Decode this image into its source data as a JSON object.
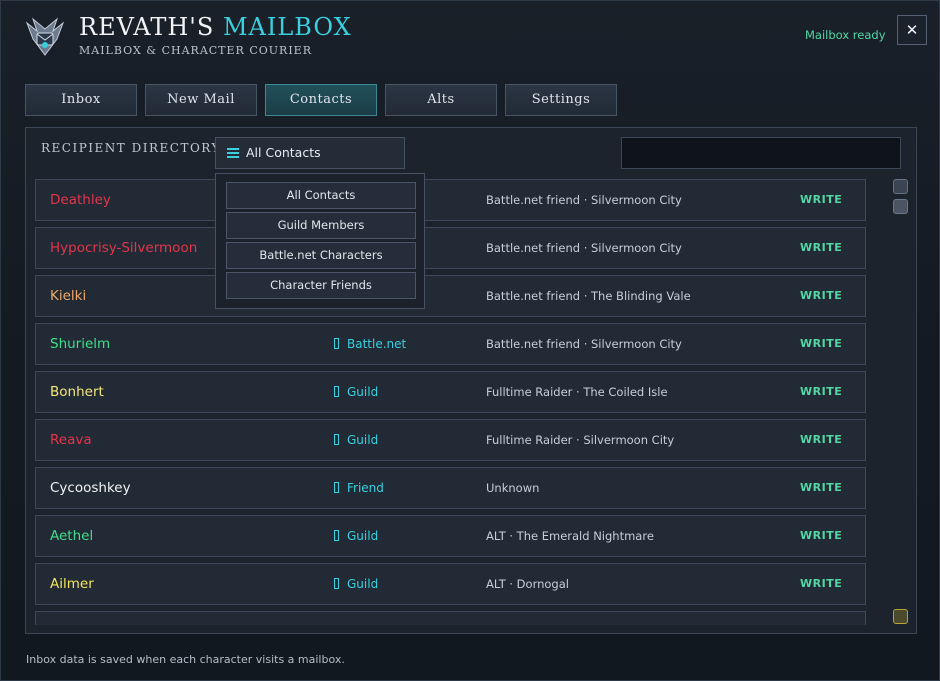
{
  "header": {
    "title_prefix": "REVATH'S",
    "title_accent": "MAILBOX",
    "subtitle": "MAILBOX & CHARACTER COURIER",
    "status": "Mailbox ready",
    "close_label": "✕"
  },
  "tabs": [
    {
      "label": "Inbox",
      "active": false
    },
    {
      "label": "New Mail",
      "active": false
    },
    {
      "label": "Contacts",
      "active": true
    },
    {
      "label": "Alts",
      "active": false
    },
    {
      "label": "Settings",
      "active": false
    }
  ],
  "directory": {
    "label": "RECIPIENT DIRECTORY",
    "filter_value": "All Contacts",
    "search_value": "",
    "filter_options": [
      "All Contacts",
      "Guild Members",
      "Battle.net Characters",
      "Character Friends"
    ]
  },
  "contacts": [
    {
      "name": "Deathley",
      "name_color": "#e5344a",
      "relation": "",
      "location": "Battle.net friend · Silvermoon City",
      "action": "WRITE"
    },
    {
      "name": "Hypocrisy-Silvermoon",
      "name_color": "#e5344a",
      "relation": "",
      "location": "Battle.net friend · Silvermoon City",
      "action": "WRITE"
    },
    {
      "name": "Kielki",
      "name_color": "#f0a86a",
      "relation": "",
      "location": "Battle.net friend · The Blinding Vale",
      "action": "WRITE"
    },
    {
      "name": "Shurielm",
      "name_color": "#3fe08c",
      "relation": "Battle.net",
      "location": "Battle.net friend · Silvermoon City",
      "action": "WRITE"
    },
    {
      "name": "Bonhert",
      "name_color": "#f4e77a",
      "relation": "Guild",
      "location": "Fulltime Raider · The Coiled Isle",
      "action": "WRITE"
    },
    {
      "name": "Reava",
      "name_color": "#e5344a",
      "relation": "Guild",
      "location": "Fulltime Raider · Silvermoon City",
      "action": "WRITE"
    },
    {
      "name": "Cycooshkey",
      "name_color": "#f2f4f6",
      "relation": "Friend",
      "location": "Unknown",
      "action": "WRITE"
    },
    {
      "name": "Aethel",
      "name_color": "#3fe08c",
      "relation": "Guild",
      "location": "ALT · The Emerald Nightmare",
      "action": "WRITE"
    },
    {
      "name": "Ailmer",
      "name_color": "#f4e65a",
      "relation": "Guild",
      "location": "ALT · Dornogal",
      "action": "WRITE"
    }
  ],
  "footer": "Inbox data is saved when each character visits a mailbox."
}
